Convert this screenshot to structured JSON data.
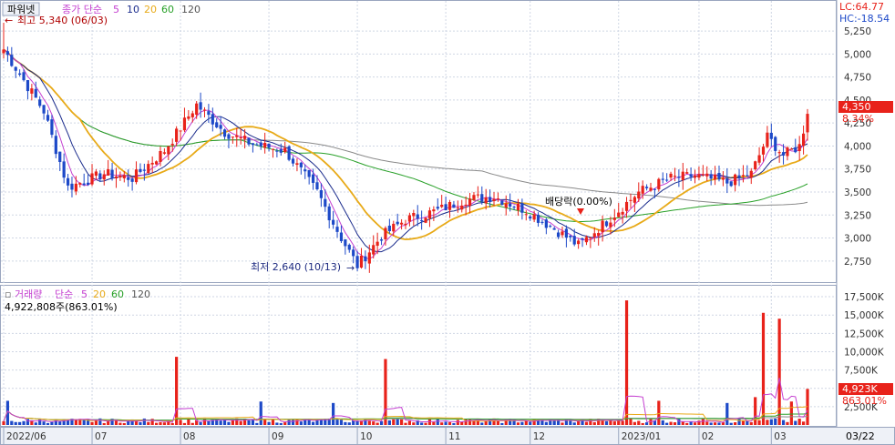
{
  "price_panel": {
    "stock_name": "파워넷",
    "legend_prefix": "종가 단순",
    "ma_periods": [
      "5",
      "10",
      "20",
      "60",
      "120"
    ],
    "max_note": "최고 5,340 (06/03)",
    "min_note": "최저 2,640 (10/13)",
    "dividend_note": "배당락(0.00%)",
    "lc": "LC:64.77",
    "hc": "HC:-18.54",
    "last_price_badge": "4,350",
    "last_change_pct": "8.34%",
    "y_tick_labels": [
      "5,250",
      "5,000",
      "4,750",
      "4,500",
      "4,250",
      "4,000",
      "3,750",
      "3,500",
      "3,250",
      "3,000",
      "2,750"
    ]
  },
  "volume_panel": {
    "title": "거래량",
    "legend_prefix": "단순",
    "ma_periods": [
      "5",
      "20",
      "60",
      "120"
    ],
    "last_volume_text": "4,922,808주(863.01%)",
    "last_volume_badge": "4,923K",
    "last_volume_pct_badge": "863.01%",
    "y_tick_labels": [
      "17,500K",
      "15,000K",
      "12,500K",
      "10,000K",
      "7,500K",
      "5,000K",
      "2,500K"
    ]
  },
  "x_axis": {
    "labels": [
      "2022/06",
      "07",
      "08",
      "09",
      "10",
      "11",
      "12",
      "2023/01",
      "02",
      "03"
    ],
    "current_date": "03/22"
  },
  "colors": {
    "up": "#e8221a",
    "down": "#1d49c8",
    "ma5": "#c43fd0",
    "ma10": "#1a2b8c",
    "ma20": "#e8aa18",
    "ma60": "#28a028",
    "ma120": "#8a8a8a",
    "grid": "#cfd6e4",
    "badge": "#e8221a"
  },
  "chart_data": {
    "type": "candlestick",
    "x_range": [
      "2022/06",
      "2023/03"
    ],
    "ylim": [
      2600,
      5330
    ],
    "y_ticks": [
      2750,
      3000,
      3250,
      3500,
      3750,
      4000,
      4250,
      4500,
      4750,
      5000,
      5250
    ],
    "volume_ylim": [
      0,
      18500
    ],
    "volume_ticks": [
      2500,
      5000,
      7500,
      10000,
      12500,
      15000,
      17500
    ],
    "volume_unit": "K",
    "max_point": {
      "price": 5340,
      "date": "06/03"
    },
    "min_point": {
      "price": 2640,
      "date": "10/13"
    },
    "last": {
      "close": 4350,
      "change_pct": 8.34,
      "volume": 4922808,
      "volume_pct": 863.01
    },
    "anchors": [
      {
        "i": 0,
        "c": 5050
      },
      {
        "i": 10,
        "c": 4380
      },
      {
        "i": 16,
        "c": 3550
      },
      {
        "i": 25,
        "c": 3700
      },
      {
        "i": 32,
        "c": 3650
      },
      {
        "i": 40,
        "c": 3950
      },
      {
        "i": 48,
        "c": 4450
      },
      {
        "i": 55,
        "c": 4150
      },
      {
        "i": 62,
        "c": 4020
      },
      {
        "i": 70,
        "c": 3950
      },
      {
        "i": 78,
        "c": 3500
      },
      {
        "i": 84,
        "c": 3000
      },
      {
        "i": 88,
        "c": 2700
      },
      {
        "i": 94,
        "c": 3020
      },
      {
        "i": 100,
        "c": 3200
      },
      {
        "i": 108,
        "c": 3300
      },
      {
        "i": 115,
        "c": 3420
      },
      {
        "i": 122,
        "c": 3450
      },
      {
        "i": 130,
        "c": 3300
      },
      {
        "i": 137,
        "c": 3100
      },
      {
        "i": 143,
        "c": 2920
      },
      {
        "i": 150,
        "c": 3180
      },
      {
        "i": 158,
        "c": 3500
      },
      {
        "i": 166,
        "c": 3650
      },
      {
        "i": 172,
        "c": 3680
      },
      {
        "i": 180,
        "c": 3600
      },
      {
        "i": 186,
        "c": 3700
      },
      {
        "i": 190,
        "c": 4100
      },
      {
        "i": 194,
        "c": 3900
      },
      {
        "i": 198,
        "c": 4000
      },
      {
        "i": 200,
        "c": 4350
      }
    ],
    "volume_spikes": [
      {
        "i": 1,
        "v": 3300
      },
      {
        "i": 43,
        "v": 9300
      },
      {
        "i": 64,
        "v": 3200
      },
      {
        "i": 82,
        "v": 3000
      },
      {
        "i": 95,
        "v": 9000
      },
      {
        "i": 155,
        "v": 17000
      },
      {
        "i": 163,
        "v": 3300
      },
      {
        "i": 180,
        "v": 3000
      },
      {
        "i": 187,
        "v": 3800
      },
      {
        "i": 189,
        "v": 15300
      },
      {
        "i": 193,
        "v": 14500
      },
      {
        "i": 196,
        "v": 3200
      },
      {
        "i": 200,
        "v": 4923
      }
    ]
  }
}
